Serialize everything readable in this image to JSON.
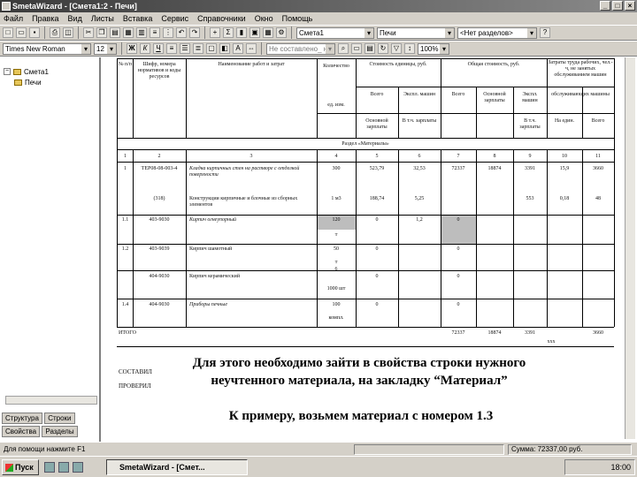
{
  "window": {
    "title": "SmetaWizard - [Смета1:2 - Печи]"
  },
  "menu": [
    "Файл",
    "Правка",
    "Вид",
    "Листы",
    "Вставка",
    "Сервис",
    "Справочники",
    "Окно",
    "Помощь"
  ],
  "toolbar1": {
    "estimate_combo": "Смета1",
    "section_combo": "Печи",
    "subsection_combo": "<Нет разделов>"
  },
  "toolbar2": {
    "font_combo": "Times New Roman",
    "size_combo": "12",
    "bold": "Ж",
    "italic": "К",
    "underline": "Ч",
    "unknown_combo": "Не составлено_ на",
    "zoom_combo": "100%"
  },
  "tree": {
    "root": "Смета1",
    "child": "Печи"
  },
  "left_tabs": [
    "Структура",
    "Строки",
    "Свойства",
    "Разделы"
  ],
  "table": {
    "headers": {
      "col1": "№ п/п",
      "col2": "Шифр, номера нормативов и коды ресурсов",
      "col3": "Наименование работ и затрат",
      "col4": "Количество",
      "col5": "Стоимость единицы, руб.",
      "col6": "Общая стоимость, руб.",
      "col7": "Затраты труда рабочих, чел.-ч, не занятых обслуживанием машин",
      "unit": "ед. изм.",
      "vsego1": "Всего",
      "eksp1": "Экспл. машин",
      "vsego2": "Всего",
      "osn_zp": "Основной зарплаты",
      "eksp2": "Экспл. машин",
      "obsl": "обслуживающих машины",
      "osn_zp2": "Основной зарплаты",
      "v_t_ch1": "В т.ч. зарплаты",
      "v_t_ch2": "В т.ч. зарплаты",
      "na_ed": "На един.",
      "vsego3": "Всего"
    },
    "section_title": "Раздел «Материалы»",
    "col_numbers": [
      "1",
      "2",
      "3",
      "4",
      "5",
      "6",
      "7",
      "8",
      "9",
      "10",
      "11"
    ],
    "rows": [
      {
        "n": "1",
        "code": "ТЕР08-08-003-4",
        "name": "Кладка кирпичных стен на растворе с отделкой поверхности",
        "qty": "300",
        "c5": "523,79",
        "c6": "32,53",
        "c7": "72337",
        "c8": "18874",
        "c9": "3391",
        "c10": "15,9",
        "c11": "3660"
      },
      {
        "n": "",
        "code": "(318)",
        "name": "Конструкции кирпичные и блочные из сборных элементов",
        "qty": "1 м3",
        "c5": "188,74",
        "c6": "5,25",
        "c7": "",
        "c8": "",
        "c9": "553",
        "c10": "0,18",
        "c11": "48"
      },
      {
        "n": "1.1",
        "code": "403-9030",
        "name": "Кирпич огнеупорный",
        "qty": "120",
        "unit": "т",
        "c5": "0",
        "c6": "1,2",
        "c7": "0"
      },
      {
        "n": "1.2",
        "code": "403-9039",
        "name": "Кирпич шамотный",
        "qty": "50",
        "unit": "т",
        "c5": "0",
        "c7": "0"
      },
      {
        "n": "1.3",
        "code": "404-9030",
        "name": "Кирпич керамический",
        "qty": "6",
        "unit": "1000 шт",
        "c5": "0",
        "c7": "0"
      },
      {
        "n": "1.4",
        "code": "404-9030",
        "name": "Приборы печные",
        "qty": "100",
        "unit": "компл.",
        "c5": "0",
        "c7": "0"
      }
    ],
    "total_label": "ИТОГО",
    "totals": {
      "c7": "72337",
      "c8": "18874",
      "c9": "3391",
      "c11": "3660"
    },
    "total_sub": "ххх",
    "sostavil": "СОСТАВИЛ",
    "proveril": "ПРОВЕРИЛ"
  },
  "captions": {
    "line1": "Для этого необходимо зайти в свойства строки нужного",
    "line2": "неучтенного материала, на закладку “Материал”",
    "line3": "К примеру, возьмем материал с номером 1.3"
  },
  "status": {
    "help": "Для помощи нажмите F1",
    "sum": "Сумма: 72337,00 руб."
  },
  "taskbar": {
    "start": "Пуск",
    "task": "SmetaWizard - [Смет...",
    "clock": "18:00"
  }
}
